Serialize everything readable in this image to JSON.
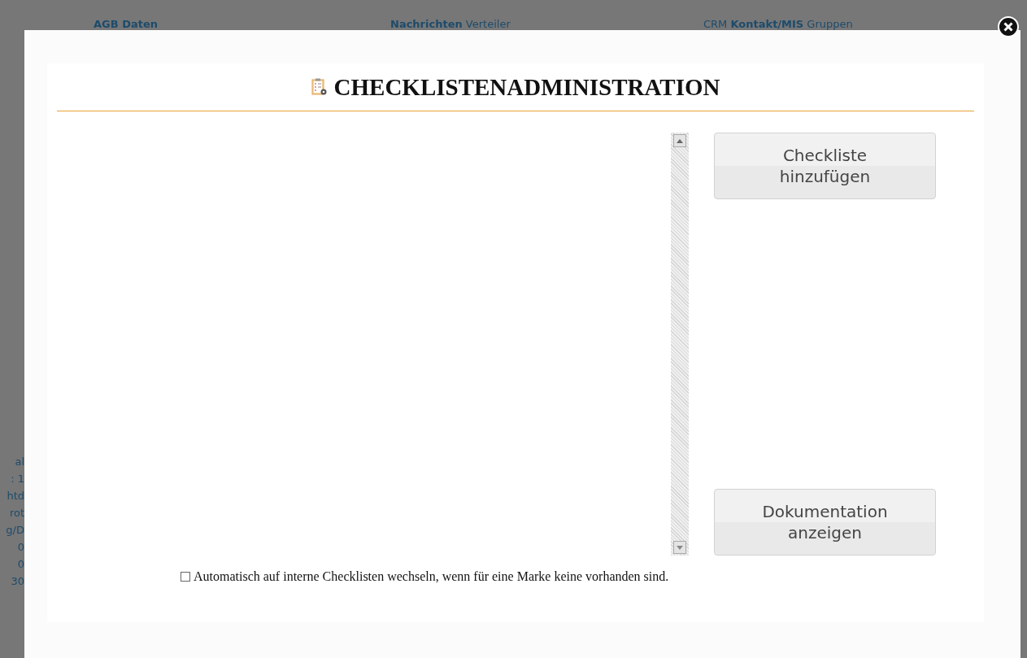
{
  "background_page": {
    "top_links": [
      {
        "text": "**AGB Daten**"
      },
      {
        "text": "**Nachrichten** Verteiler"
      },
      {
        "text": "CRM **Kontakt/MIS** Gruppen"
      }
    ],
    "left_fragments": [
      "al",
      ": 1",
      "htd",
      "rot",
      "g/D",
      "0",
      "0",
      "30"
    ]
  },
  "dialog": {
    "title": "CHECKLISTENADMINISTRATION",
    "buttons": [
      "Checkliste hinzufügen",
      "Dokumentation anzeigen"
    ],
    "option": {
      "label": "Automatisch auf interne Checklisten wechseln, wenn für eine Marke keine vorhanden sind.",
      "checked": false
    }
  }
}
